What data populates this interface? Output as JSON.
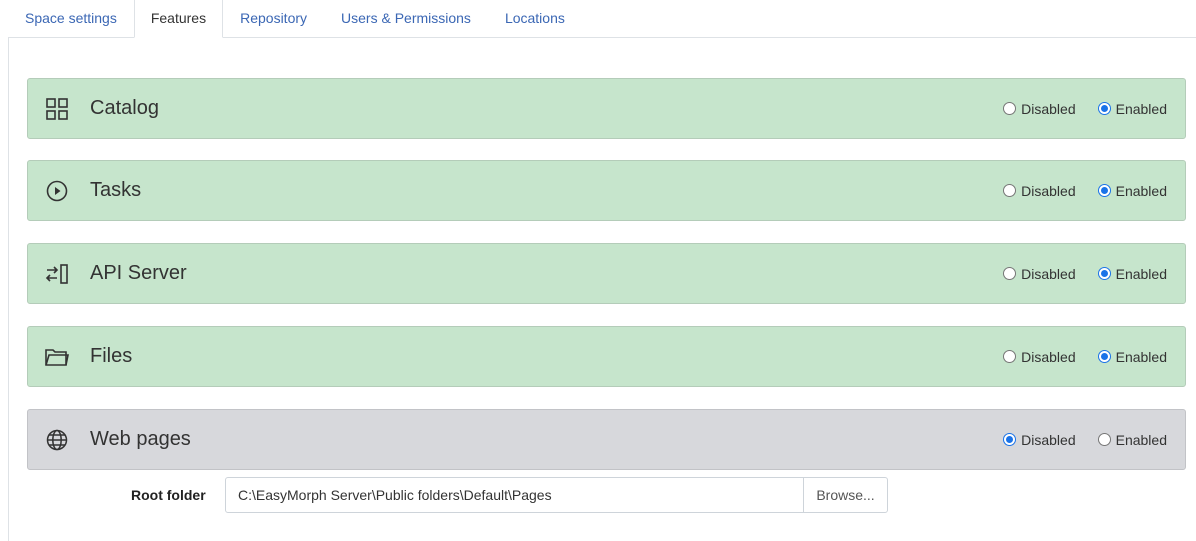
{
  "tabs": [
    {
      "label": "Space settings",
      "active": false
    },
    {
      "label": "Features",
      "active": true
    },
    {
      "label": "Repository",
      "active": false
    },
    {
      "label": "Users & Permissions",
      "active": false
    },
    {
      "label": "Locations",
      "active": false
    }
  ],
  "features": [
    {
      "title": "Catalog",
      "icon": "grid-icon",
      "state": "Enabled"
    },
    {
      "title": "Tasks",
      "icon": "play-circle-icon",
      "state": "Enabled"
    },
    {
      "title": "API Server",
      "icon": "api-arrows-icon",
      "state": "Enabled"
    },
    {
      "title": "Files",
      "icon": "folder-icon",
      "state": "Enabled"
    },
    {
      "title": "Web pages",
      "icon": "globe-icon",
      "state": "Disabled"
    }
  ],
  "radio_labels": {
    "disabled": "Disabled",
    "enabled": "Enabled"
  },
  "colors": {
    "enabled_bg": "#c6e5cc",
    "disabled_bg": "#d7d8dc",
    "tab_link": "#3b67b4",
    "radio_accent": "#1a73e8"
  },
  "root_folder": {
    "label": "Root folder",
    "value": "C:\\EasyMorph Server\\Public folders\\Default\\Pages",
    "browse_label": "Browse..."
  }
}
